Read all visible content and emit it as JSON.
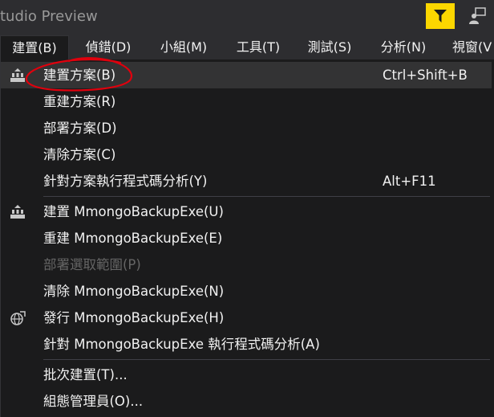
{
  "window": {
    "title": "tudio Preview"
  },
  "titlebar": {
    "feedback_icon": "feedback-funnel-icon",
    "share_icon": "live-share-icon",
    "feedback_color": "#fcd700"
  },
  "menubar": {
    "items": [
      {
        "label": "建置(B)",
        "active": true
      },
      {
        "label": "偵錯(D)"
      },
      {
        "label": "小組(M)"
      },
      {
        "label": "工具(T)"
      },
      {
        "label": "測試(S)"
      },
      {
        "label": "分析(N)"
      },
      {
        "label": "視窗(V"
      }
    ]
  },
  "dropdown": {
    "items": [
      {
        "label": "建置方案(B)",
        "shortcut": "Ctrl+Shift+B",
        "icon": "build-solution-icon",
        "highlighted": true
      },
      {
        "label": "重建方案(R)"
      },
      {
        "label": "部署方案(D)"
      },
      {
        "label": "清除方案(C)"
      },
      {
        "label": "針對方案執行程式碼分析(Y)",
        "shortcut": "Alt+F11"
      },
      {
        "label": "建置 MmongoBackupExe(U)",
        "icon": "build-project-icon"
      },
      {
        "label": "重建 MmongoBackupExe(E)"
      },
      {
        "label": "部署選取範圍(P)",
        "disabled": true
      },
      {
        "label": "清除 MmongoBackupExe(N)"
      },
      {
        "label": "發行 MmongoBackupExe(H)",
        "icon": "publish-globe-icon"
      },
      {
        "label": "針對 MmongoBackupExe 執行程式碼分析(A)"
      },
      {
        "label": "批次建置(T)..."
      },
      {
        "label": "組態管理員(O)..."
      }
    ]
  },
  "annotation": {
    "color": "#e0000d",
    "shape": "hand-drawn circle around 建置方案(B)"
  }
}
